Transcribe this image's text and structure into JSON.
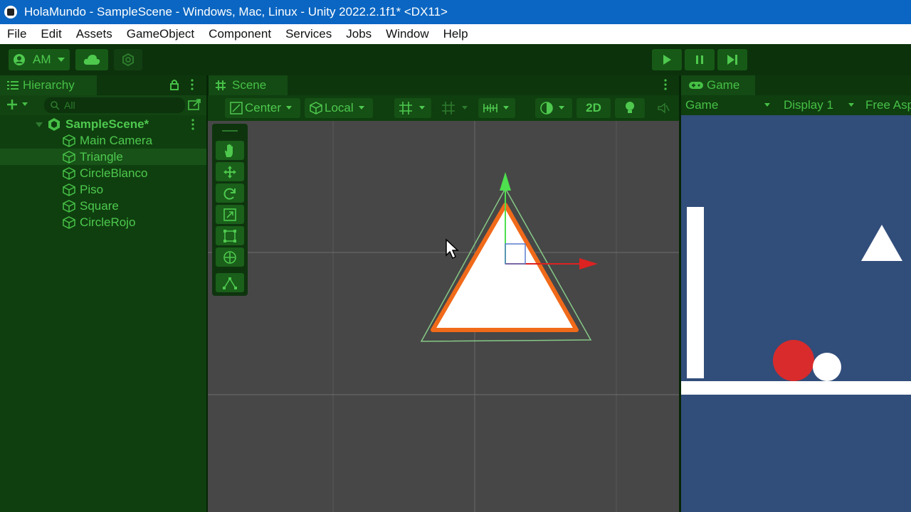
{
  "window": {
    "title": "HolaMundo - SampleScene - Windows, Mac, Linux - Unity 2022.2.1f1* <DX11>"
  },
  "menu": [
    "File",
    "Edit",
    "Assets",
    "GameObject",
    "Component",
    "Services",
    "Jobs",
    "Window",
    "Help"
  ],
  "toolbar": {
    "account_label": "AM"
  },
  "hierarchy": {
    "tab_label": "Hierarchy",
    "search_placeholder": "All",
    "scene_name": "SampleScene*",
    "items": [
      "Main Camera",
      "Triangle",
      "CircleBlanco",
      "Piso",
      "Square",
      "CircleRojo"
    ],
    "selected_item": "Triangle"
  },
  "scene": {
    "tab_label": "Scene",
    "pivot_label": "Center",
    "space_label": "Local",
    "mode_2d_label": "2D"
  },
  "game": {
    "tab_label": "Game",
    "view_label": "Game",
    "display_label": "Display 1",
    "aspect_label": "Free Asp"
  },
  "colors": {
    "theme_green": "#4ec94e",
    "titlebar_blue": "#0a66c2",
    "scene_bg": "#474747",
    "game_bg": "#314d7a",
    "selection_outline": "#f06a1a",
    "circle_red": "#d92b2b"
  }
}
